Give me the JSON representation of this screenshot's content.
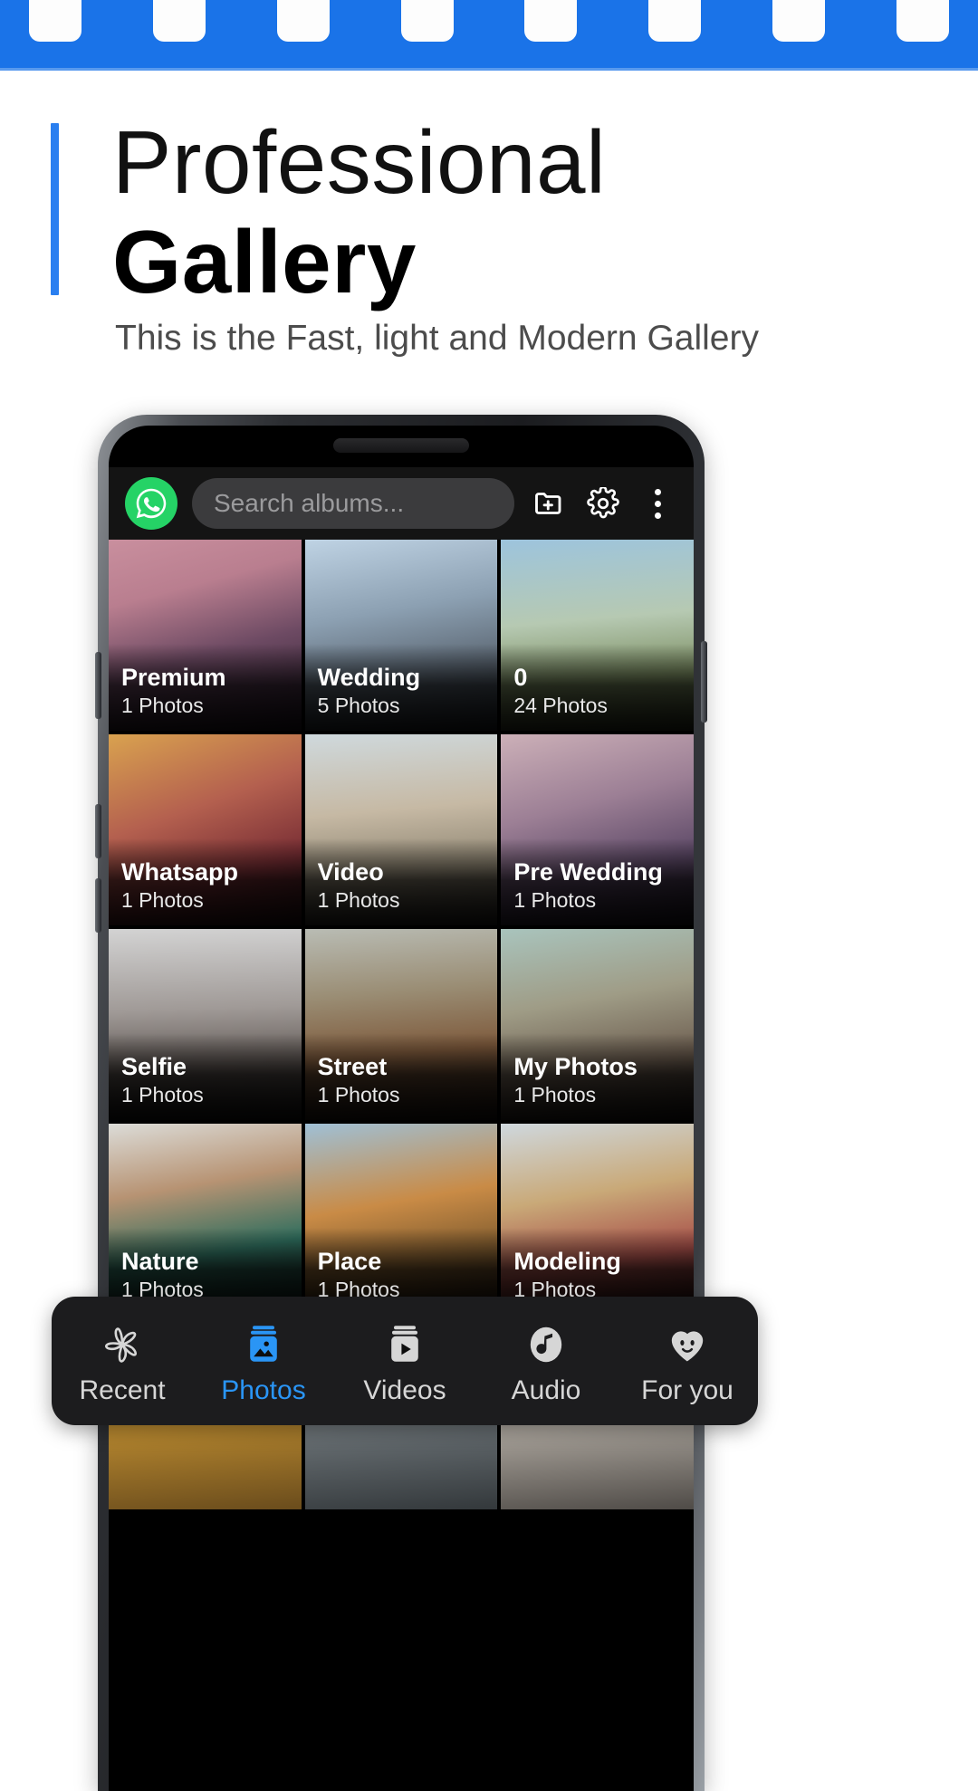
{
  "banner": {
    "color": "#1a73e8",
    "perforation_color": "#fdfdfd",
    "perforation_count": 8,
    "name": "film-strip-banner"
  },
  "header": {
    "accent_color": "#2a7ff0",
    "title_line1": "Professional",
    "title_line2": "Gallery",
    "subtitle": "This is the Fast, light and Modern Gallery"
  },
  "phone": {
    "appbar": {
      "app_icon": "whatsapp-icon",
      "app_icon_color": "#25D366",
      "search_placeholder": "Search albums...",
      "search_value": "",
      "add_folder_label": "add-folder-icon",
      "settings_label": "gear-icon",
      "overflow_label": "more-options-icon"
    },
    "albums": [
      {
        "name": "Premium",
        "count": "1 Photos",
        "img": "superhero-city-sunset"
      },
      {
        "name": "Wedding",
        "count": "5 Photos",
        "img": "mountain-valley-woman"
      },
      {
        "name": "0",
        "count": "24 Photos",
        "img": "woman-plaid-field"
      },
      {
        "name": "Whatsapp",
        "count": "1 Photos",
        "img": "woman-red-sunglasses"
      },
      {
        "name": "Video",
        "count": "1 Photos",
        "img": "woman-white-tshirt"
      },
      {
        "name": "Pre Wedding",
        "count": "1 Photos",
        "img": "woman-purple-sunglasses"
      },
      {
        "name": "Selfie",
        "count": "1 Photos",
        "img": "woman-black-hat"
      },
      {
        "name": "Street",
        "count": "1 Photos",
        "img": "woman-orange-shirt"
      },
      {
        "name": "My Photos",
        "count": "1 Photos",
        "img": "woman-curly-hair"
      },
      {
        "name": "Nature",
        "count": "1 Photos",
        "img": "woman-green-jacket"
      },
      {
        "name": "Place",
        "count": "1 Photos",
        "img": "woman-autumn-field"
      },
      {
        "name": "Modeling",
        "count": "1 Photos",
        "img": "woman-red-sunglasses-smile"
      },
      {
        "name": "",
        "count": "",
        "img": "partial-yellow"
      },
      {
        "name": "",
        "count": "",
        "img": "partial-grey"
      },
      {
        "name": "",
        "count": "",
        "img": "partial-light"
      }
    ],
    "bottom_nav": {
      "active_color": "#2a95f5",
      "inactive_color": "#d6d6d6",
      "items": [
        {
          "label": "Recent",
          "icon": "flower-icon",
          "active": false
        },
        {
          "label": "Photos",
          "icon": "image-icon",
          "active": true
        },
        {
          "label": "Videos",
          "icon": "video-icon",
          "active": false
        },
        {
          "label": "Audio",
          "icon": "music-icon",
          "active": false
        },
        {
          "label": "For you",
          "icon": "heart-face-icon",
          "active": false
        }
      ]
    }
  }
}
